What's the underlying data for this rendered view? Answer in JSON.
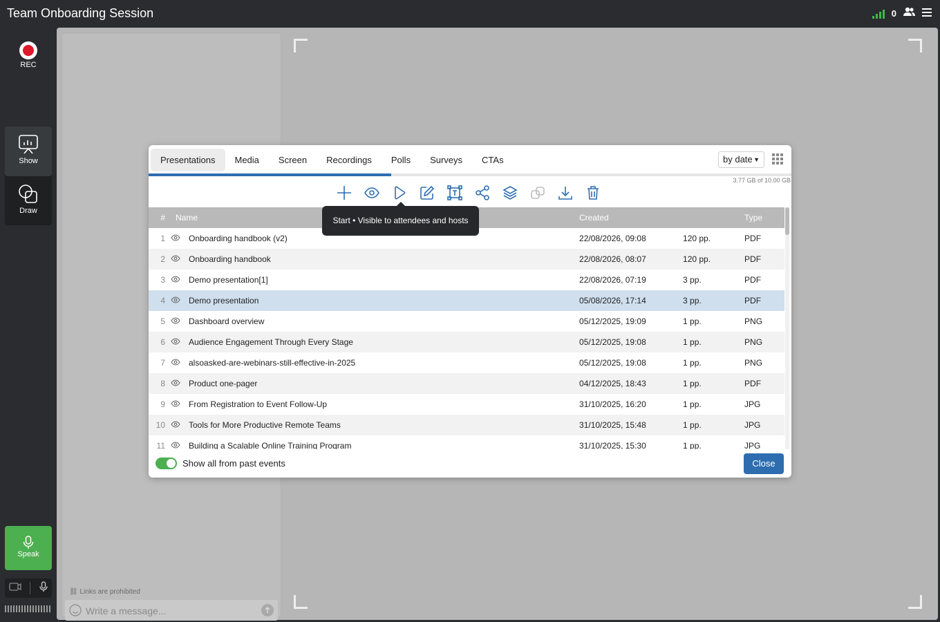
{
  "app": {
    "title": "Team Onboarding Session",
    "participants": "0"
  },
  "rail": {
    "rec": "REC",
    "show": "Show",
    "draw": "Draw",
    "speak": "Speak"
  },
  "chat": {
    "links_note": "Links are prohibited",
    "placeholder": "Write a message..."
  },
  "modal": {
    "tabs": [
      "Presentations",
      "Media",
      "Screen",
      "Recordings",
      "Polls",
      "Surveys",
      "CTAs"
    ],
    "active_tab": "Presentations",
    "sort": "by date",
    "storage": "3.77 GB of 10.00 GB",
    "storage_used_fraction": 0.377,
    "tooltip": "Start • Visible to attendees and hosts",
    "columns": {
      "num": "#",
      "name": "Name",
      "created": "Created",
      "type": "Type"
    },
    "rows": [
      {
        "num": "1",
        "name": "Onboarding handbook (v2)",
        "created": "22/08/2026, 09:08",
        "pages": "120 pp.",
        "type": "PDF"
      },
      {
        "num": "2",
        "name": "Onboarding handbook",
        "created": "22/08/2026, 08:07",
        "pages": "120 pp.",
        "type": "PDF"
      },
      {
        "num": "3",
        "name": "Demo presentation[1]",
        "created": "22/08/2026, 07:19",
        "pages": "3 pp.",
        "type": "PDF"
      },
      {
        "num": "4",
        "name": "Demo presentation",
        "created": "05/08/2026, 17:14",
        "pages": "3 pp.",
        "type": "PDF"
      },
      {
        "num": "5",
        "name": "Dashboard overview",
        "created": "05/12/2025, 19:09",
        "pages": "1 pp.",
        "type": "PNG"
      },
      {
        "num": "6",
        "name": "Audience Engagement Through Every Stage",
        "created": "05/12/2025, 19:08",
        "pages": "1 pp.",
        "type": "PNG"
      },
      {
        "num": "7",
        "name": "alsoasked-are-webinars-still-effective-in-2025",
        "created": "05/12/2025, 19:08",
        "pages": "1 pp.",
        "type": "PNG"
      },
      {
        "num": "8",
        "name": "Product one-pager",
        "created": "04/12/2025, 18:43",
        "pages": "1 pp.",
        "type": "PDF"
      },
      {
        "num": "9",
        "name": "From Registration to Event Follow-Up",
        "created": "31/10/2025, 16:20",
        "pages": "1 pp.",
        "type": "JPG"
      },
      {
        "num": "10",
        "name": "Tools for More Productive Remote Teams",
        "created": "31/10/2025, 15:48",
        "pages": "1 pp.",
        "type": "JPG"
      },
      {
        "num": "11",
        "name": "Building a Scalable Online Training Program",
        "created": "31/10/2025, 15:30",
        "pages": "1 pp.",
        "type": "JPG"
      }
    ],
    "selected_row": "4",
    "footer": {
      "toggle_label": "Show all from past events",
      "toggle_on": true,
      "close": "Close"
    }
  },
  "colors": {
    "accent": "#2e6db0",
    "toggle_green": "#4caf50",
    "rec_red": "#e0182b",
    "selected_row": "#cfdfee"
  }
}
